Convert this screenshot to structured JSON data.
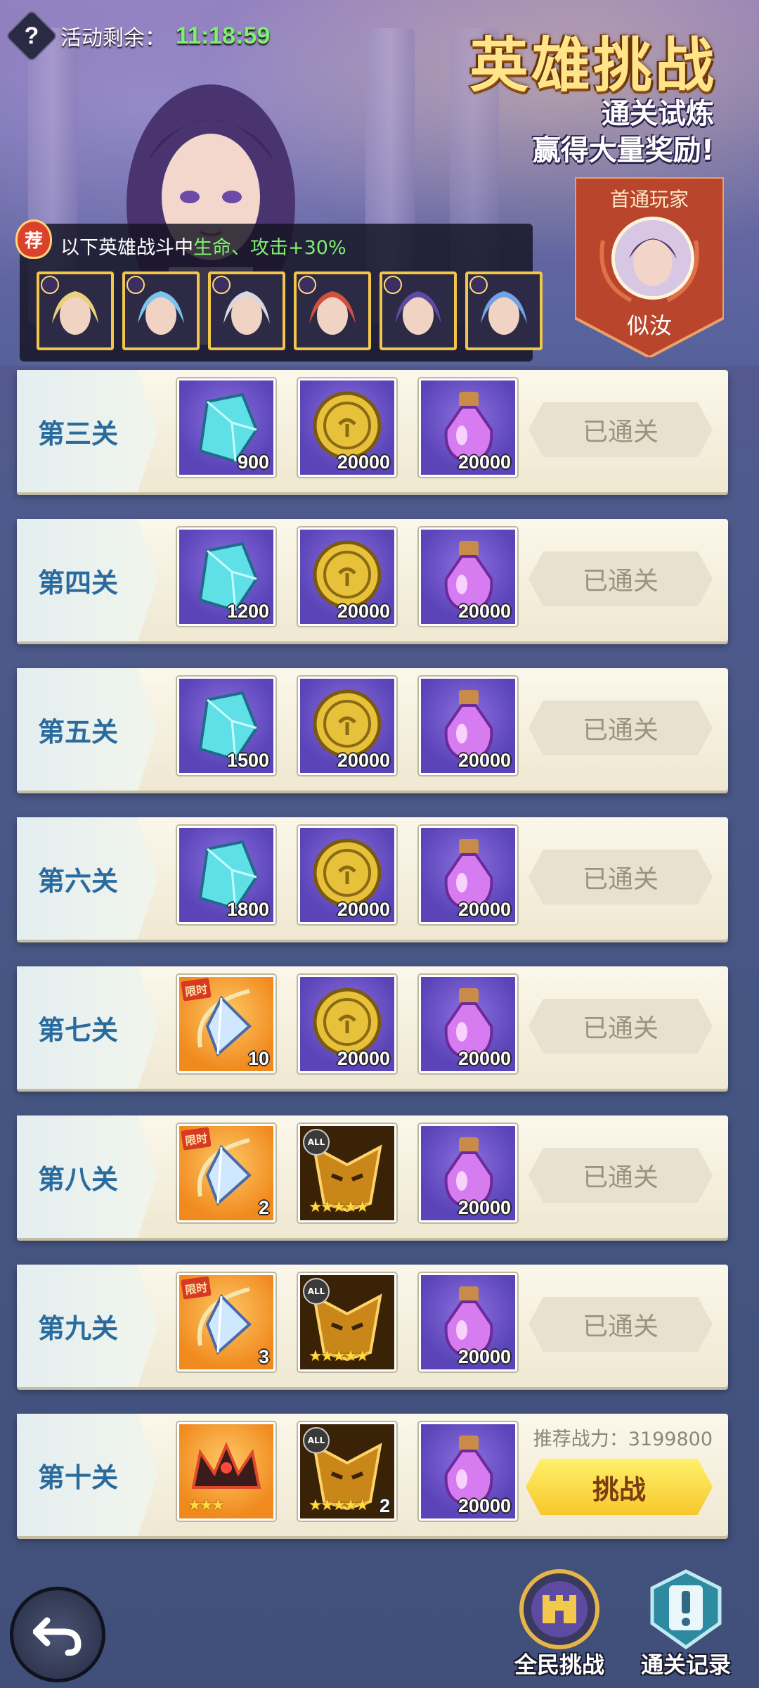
{
  "header": {
    "help_icon": "?",
    "timer_label": "活动剩余：",
    "timer_value": "11:18:59",
    "title": "英雄挑战",
    "subtitle_line1": "通关试炼",
    "subtitle_line2": "赢得大量奖励!",
    "first_clear_title": "首通玩家",
    "first_clear_name": "似汝"
  },
  "bonus": {
    "badge": "荐",
    "text_prefix": "以下英雄战斗中",
    "text_highlight": "生命、攻击+30%",
    "heroes": [
      {
        "name": "hero-1",
        "color": "#e9d27a"
      },
      {
        "name": "hero-2",
        "color": "#7cc4f0"
      },
      {
        "name": "hero-3",
        "color": "#d9d6de"
      },
      {
        "name": "hero-4",
        "color": "#d0523c"
      },
      {
        "name": "hero-5",
        "color": "#5e4aa0"
      },
      {
        "name": "hero-6",
        "color": "#6fa3e6"
      }
    ]
  },
  "stages": [
    {
      "name": "第三关",
      "rewards": [
        {
          "type": "crystal",
          "qty": "900"
        },
        {
          "type": "coin",
          "qty": "20000"
        },
        {
          "type": "potion",
          "qty": "20000"
        }
      ],
      "status": "已通关"
    },
    {
      "name": "第四关",
      "rewards": [
        {
          "type": "crystal",
          "qty": "1200"
        },
        {
          "type": "coin",
          "qty": "20000"
        },
        {
          "type": "potion",
          "qty": "20000"
        }
      ],
      "status": "已通关"
    },
    {
      "name": "第五关",
      "rewards": [
        {
          "type": "crystal",
          "qty": "1500"
        },
        {
          "type": "coin",
          "qty": "20000"
        },
        {
          "type": "potion",
          "qty": "20000"
        }
      ],
      "status": "已通关"
    },
    {
      "name": "第六关",
      "rewards": [
        {
          "type": "crystal",
          "qty": "1800"
        },
        {
          "type": "coin",
          "qty": "20000"
        },
        {
          "type": "potion",
          "qty": "20000"
        }
      ],
      "status": "已通关"
    },
    {
      "name": "第七关",
      "rewards": [
        {
          "type": "shard",
          "qty": "10",
          "tag": "限时"
        },
        {
          "type": "coin",
          "qty": "20000"
        },
        {
          "type": "potion",
          "qty": "20000"
        }
      ],
      "status": "已通关"
    },
    {
      "name": "第八关",
      "rewards": [
        {
          "type": "shard",
          "qty": "2",
          "tag": "限时"
        },
        {
          "type": "mask",
          "qty": "",
          "tag": "ALL",
          "stars": "★★★★★"
        },
        {
          "type": "potion",
          "qty": "20000"
        }
      ],
      "status": "已通关"
    },
    {
      "name": "第九关",
      "rewards": [
        {
          "type": "shard",
          "qty": "3",
          "tag": "限时"
        },
        {
          "type": "mask",
          "qty": "",
          "tag": "ALL",
          "stars": "★★★★★"
        },
        {
          "type": "potion",
          "qty": "20000"
        }
      ],
      "status": "已通关"
    },
    {
      "name": "第十关",
      "rewards": [
        {
          "type": "crown",
          "qty": "",
          "stars": "★★★"
        },
        {
          "type": "mask",
          "qty": "2",
          "tag": "ALL",
          "stars": "★★★★★"
        },
        {
          "type": "potion",
          "qty": "20000"
        }
      ],
      "status": "",
      "power": "推荐战力：3199800",
      "action": "挑战"
    }
  ],
  "bottom": {
    "challenge_all": "全民挑战",
    "records": "通关记录"
  }
}
